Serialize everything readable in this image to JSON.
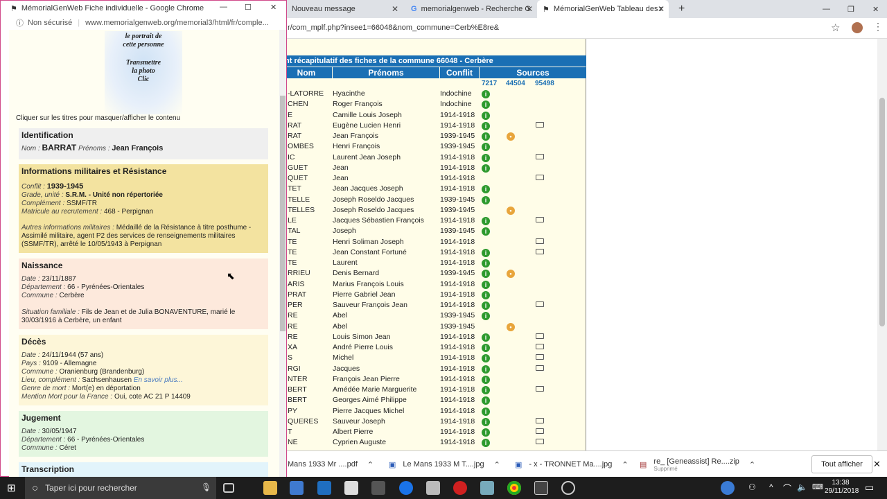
{
  "bg_tabs": [
    {
      "label": "Nouveau message"
    },
    {
      "label": "memorialgenweb - Recherche G"
    },
    {
      "label": "MémorialGenWeb Tableau des r"
    }
  ],
  "bg_url": "r/com_mplf.php?insee1=66048&nom_commune=Cerb%E8re&",
  "table": {
    "title": "nt récapitulatif des fiches de la commune 66048 - Cerbère",
    "headers": {
      "nom": "Nom",
      "prenoms": "Prénoms",
      "conflit": "Conflit",
      "sources": "Sources"
    },
    "source_ids": [
      "7217",
      "44504",
      "95498"
    ],
    "rows": [
      {
        "nom": "-LATORRE",
        "prenom": "Hyacinthe",
        "conflit": "Indochine",
        "s1": "g",
        "s2": "",
        "s3": ""
      },
      {
        "nom": "CHEN",
        "prenom": "Roger François",
        "conflit": "Indochine",
        "s1": "g",
        "s2": "",
        "s3": ""
      },
      {
        "nom": "E",
        "prenom": "Camille Louis Joseph",
        "conflit": "1914-1918",
        "s1": "g",
        "s2": "",
        "s3": ""
      },
      {
        "nom": "RAT",
        "prenom": "Eugène Lucien Henri",
        "conflit": "1914-1918",
        "s1": "g",
        "s2": "",
        "s3": "b"
      },
      {
        "nom": "RAT",
        "prenom": "Jean François",
        "conflit": "1939-1945",
        "s1": "g",
        "s2": "o",
        "s3": ""
      },
      {
        "nom": "OMBES",
        "prenom": "Henri François",
        "conflit": "1939-1945",
        "s1": "g",
        "s2": "",
        "s3": ""
      },
      {
        "nom": "IC",
        "prenom": "Laurent Jean Joseph",
        "conflit": "1914-1918",
        "s1": "g",
        "s2": "",
        "s3": "b"
      },
      {
        "nom": "GUET",
        "prenom": "Jean",
        "conflit": "1914-1918",
        "s1": "g",
        "s2": "",
        "s3": ""
      },
      {
        "nom": "QUET",
        "prenom": "Jean",
        "conflit": "1914-1918",
        "s1": "",
        "s2": "",
        "s3": "b"
      },
      {
        "nom": "TET",
        "prenom": "Jean Jacques Joseph",
        "conflit": "1914-1918",
        "s1": "g",
        "s2": "",
        "s3": ""
      },
      {
        "nom": "TELLE",
        "prenom": "Joseph Roseldo Jacques",
        "conflit": "1939-1945",
        "s1": "g",
        "s2": "",
        "s3": ""
      },
      {
        "nom": "TELLES",
        "prenom": "Joseph Roseldo Jacques",
        "conflit": "1939-1945",
        "s1": "",
        "s2": "o",
        "s3": ""
      },
      {
        "nom": "LE",
        "prenom": "Jacques Sébastien François",
        "conflit": "1914-1918",
        "s1": "g",
        "s2": "",
        "s3": "b"
      },
      {
        "nom": "TAL",
        "prenom": "Joseph",
        "conflit": "1939-1945",
        "s1": "g",
        "s2": "",
        "s3": ""
      },
      {
        "nom": "TE",
        "prenom": "Henri Soliman Joseph",
        "conflit": "1914-1918",
        "s1": "",
        "s2": "",
        "s3": "b"
      },
      {
        "nom": "TE",
        "prenom": "Jean Constant Fortuné",
        "conflit": "1914-1918",
        "s1": "g",
        "s2": "",
        "s3": "b"
      },
      {
        "nom": "TE",
        "prenom": "Laurent",
        "conflit": "1914-1918",
        "s1": "g",
        "s2": "",
        "s3": ""
      },
      {
        "nom": "RRIEU",
        "prenom": "Denis Bernard",
        "conflit": "1939-1945",
        "s1": "g",
        "s2": "o",
        "s3": ""
      },
      {
        "nom": "ARIS",
        "prenom": "Marius François Louis",
        "conflit": "1914-1918",
        "s1": "g",
        "s2": "",
        "s3": ""
      },
      {
        "nom": "PRAT",
        "prenom": "Pierre Gabriel Jean",
        "conflit": "1914-1918",
        "s1": "g",
        "s2": "",
        "s3": ""
      },
      {
        "nom": "PER",
        "prenom": "Sauveur François Jean",
        "conflit": "1914-1918",
        "s1": "g",
        "s2": "",
        "s3": "b"
      },
      {
        "nom": "RE",
        "prenom": "Abel",
        "conflit": "1939-1945",
        "s1": "g",
        "s2": "",
        "s3": ""
      },
      {
        "nom": "RE",
        "prenom": "Abel",
        "conflit": "1939-1945",
        "s1": "",
        "s2": "o",
        "s3": ""
      },
      {
        "nom": "RE",
        "prenom": "Louis Simon Jean",
        "conflit": "1914-1918",
        "s1": "g",
        "s2": "",
        "s3": "b"
      },
      {
        "nom": "XA",
        "prenom": "André Pierre Louis",
        "conflit": "1914-1918",
        "s1": "g",
        "s2": "",
        "s3": "b"
      },
      {
        "nom": "S",
        "prenom": "Michel",
        "conflit": "1914-1918",
        "s1": "g",
        "s2": "",
        "s3": "b"
      },
      {
        "nom": "RGI",
        "prenom": "Jacques",
        "conflit": "1914-1918",
        "s1": "g",
        "s2": "",
        "s3": "b"
      },
      {
        "nom": "NTER",
        "prenom": "François Jean Pierre",
        "conflit": "1914-1918",
        "s1": "g",
        "s2": "",
        "s3": ""
      },
      {
        "nom": "BERT",
        "prenom": "Amédée Marie Marguerite",
        "conflit": "1914-1918",
        "s1": "g",
        "s2": "",
        "s3": "b"
      },
      {
        "nom": "BERT",
        "prenom": "Georges Aimé Philippe",
        "conflit": "1914-1918",
        "s1": "g",
        "s2": "",
        "s3": ""
      },
      {
        "nom": "PY",
        "prenom": "Pierre Jacques Michel",
        "conflit": "1914-1918",
        "s1": "g",
        "s2": "",
        "s3": ""
      },
      {
        "nom": "QUERES",
        "prenom": "Sauveur Joseph",
        "conflit": "1914-1918",
        "s1": "g",
        "s2": "",
        "s3": "b"
      },
      {
        "nom": "T",
        "prenom": "Albert Pierre",
        "conflit": "1914-1918",
        "s1": "g",
        "s2": "",
        "s3": "b"
      },
      {
        "nom": "NE",
        "prenom": "Cyprien Auguste",
        "conflit": "1914-1918",
        "s1": "g",
        "s2": "",
        "s3": "b"
      }
    ]
  },
  "downloads": [
    {
      "label": "Mans 1933 Mr ....pdf"
    },
    {
      "label": "Le Mans 1933 M T....jpg"
    },
    {
      "label": "- x - TRONNET Ma....jpg"
    },
    {
      "label": "re_ [Geneassist] Re....zip",
      "sub": "Supprimé"
    }
  ],
  "show_all": "Tout afficher",
  "popup": {
    "title": "MémorialGenWeb Fiche individuelle - Google Chrome",
    "not_secure": "Non sécurisé",
    "url": "www.memorialgenweb.org/memorial3/html/fr/comple...",
    "photo_text1": "le portrait de",
    "photo_text2": "cette personne",
    "photo_text3": "Transmettre",
    "photo_text4": "la photo",
    "photo_text5": "Clic",
    "hint": "Cliquer sur les titres pour masquer/afficher le contenu",
    "ident": {
      "title": "Identification",
      "nom_label": "Nom :",
      "nom": "BARRAT",
      "prenoms_label": "Prénoms :",
      "prenoms": "Jean François"
    },
    "mil": {
      "title": "Informations militaires et Résistance",
      "conflit_label": "Conflit :",
      "conflit": "1939-1945",
      "grade_label": "Grade, unité :",
      "grade": "S.R.M. - Unité non répertoriée",
      "complement_label": "Complément :",
      "complement": "SSMF/TR",
      "matricule_label": "Matricule au recrutement :",
      "matricule": "468 - Perpignan",
      "autres_label": "Autres informations militaires :",
      "autres": "Médaillé de la Résistance à titre posthume - Assimilé militaire, agent P2 des services de renseignements militaires (SSMF/TR), arrêté le 10/05/1943 à Perpignan"
    },
    "naissance": {
      "title": "Naissance",
      "date_label": "Date :",
      "date": "23/11/1887",
      "dep_label": "Département :",
      "dep": "66 - Pyrénées-Orientales",
      "commune_label": "Commune :",
      "commune": "Cerbère",
      "sit_label": "Situation familiale :",
      "sit": "Fils de Jean et de Julia BONAVENTURE, marié le 30/03/1916 à Cerbère, un enfant"
    },
    "deces": {
      "title": "Décès",
      "date_label": "Date :",
      "date": "24/11/1944  (57 ans)",
      "pays_label": "Pays :",
      "pays": "9109 - Allemagne",
      "commune_label": "Commune :",
      "commune": "Oranienburg (Brandenburg)",
      "lieu_label": "Lieu, complément :",
      "lieu": "Sachsenhausen",
      "lieu_link": "En savoir plus...",
      "genre_label": "Genre de mort :",
      "genre": "Mort(e) en déportation",
      "mention_label": "Mention Mort pour la France :",
      "mention": "Oui, cote AC 21 P 14409"
    },
    "jugement": {
      "title": "Jugement",
      "date_label": "Date :",
      "date": "30/05/1947",
      "dep_label": "Département :",
      "dep": "66 - Pyrénées-Orientales",
      "commune_label": "Commune :",
      "commune": "Céret"
    },
    "transcription": {
      "title": "Transcription"
    }
  },
  "taskbar": {
    "search_placeholder": "Taper ici pour rechercher",
    "time": "13:38",
    "date": "29/11/2018"
  },
  "colors": {
    "header_blue": "#1a6fb4",
    "ident_bg": "#efefef",
    "mil_bg": "#f3e3a0",
    "naissance_bg": "#fde9dc",
    "deces_bg": "#fdf6d8",
    "jugement_bg": "#e3f6e0",
    "transcription_bg": "#e2f4fb"
  }
}
